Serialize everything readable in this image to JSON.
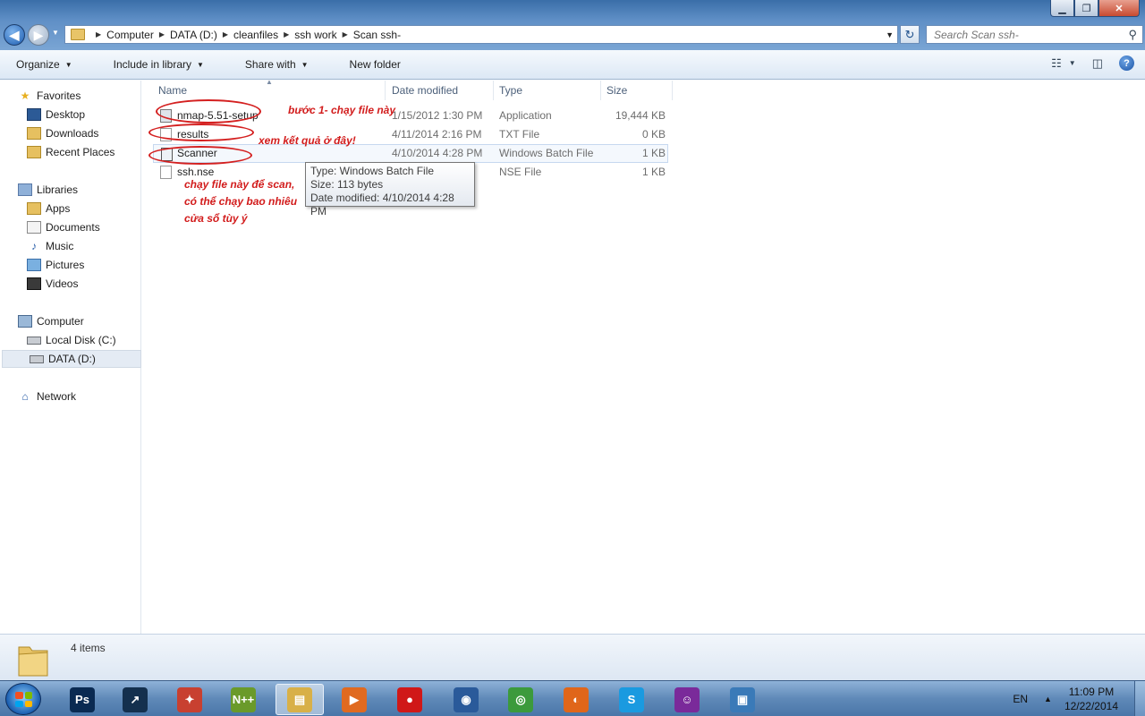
{
  "window": {
    "min_label": "▁",
    "max_label": "❐",
    "close_label": "✕"
  },
  "address": {
    "crumbs": [
      "Computer",
      "DATA (D:)",
      "cleanfiles",
      "ssh work",
      "Scan ssh-"
    ]
  },
  "search": {
    "placeholder": "Search Scan ssh-"
  },
  "toolbar": {
    "organize": "Organize",
    "include": "Include in library",
    "share": "Share with",
    "new_folder": "New folder"
  },
  "nav": {
    "favorites": "Favorites",
    "desktop": "Desktop",
    "downloads": "Downloads",
    "recent": "Recent Places",
    "libraries": "Libraries",
    "apps": "Apps",
    "documents": "Documents",
    "music": "Music",
    "pictures": "Pictures",
    "videos": "Videos",
    "computer": "Computer",
    "local_disk": "Local Disk (C:)",
    "data_disk": "DATA (D:)",
    "network": "Network"
  },
  "columns": {
    "name": "Name",
    "date": "Date modified",
    "type": "Type",
    "size": "Size"
  },
  "files": [
    {
      "name": "nmap-5.51-setup",
      "date": "1/15/2012 1:30 PM",
      "type": "Application",
      "size": "19,444 KB"
    },
    {
      "name": "results",
      "date": "4/11/2014 2:16 PM",
      "type": "TXT File",
      "size": "0 KB"
    },
    {
      "name": "Scanner",
      "date": "4/10/2014 4:28 PM",
      "type": "Windows Batch File",
      "size": "1 KB"
    },
    {
      "name": "ssh.nse",
      "date": "",
      "type": "NSE File",
      "size": "1 KB"
    }
  ],
  "tooltip": {
    "type": "Type: Windows Batch File",
    "size": "Size: 113 bytes",
    "date": "Date modified: 4/10/2014 4:28 PM"
  },
  "annotations": {
    "step1": "bước 1- chạy file này",
    "results": "xem kết quả ở đây!",
    "scan_line1": "chạy file này để scan,",
    "scan_line2": "có thể chạy bao nhiêu",
    "scan_line3": "cửa sổ tùy ý"
  },
  "details": {
    "count": "4 items"
  },
  "taskbar": {
    "apps": [
      {
        "name": "photoshop",
        "label": "Ps",
        "color": "#0a2a52"
      },
      {
        "name": "stocks",
        "label": "↗",
        "color": "#14304e"
      },
      {
        "name": "tools",
        "label": "✦",
        "color": "#c84030"
      },
      {
        "name": "notepadpp",
        "label": "N++",
        "color": "#6a9a2a"
      },
      {
        "name": "explorer",
        "label": "▤",
        "color": "#d8b048"
      },
      {
        "name": "media",
        "label": "▶",
        "color": "#e06a20"
      },
      {
        "name": "record",
        "label": "●",
        "color": "#d01818"
      },
      {
        "name": "player",
        "label": "◉",
        "color": "#2a5a9a"
      },
      {
        "name": "chrome",
        "label": "◎",
        "color": "#3c9a3c"
      },
      {
        "name": "firefox",
        "label": "◐",
        "color": "#e0661a"
      },
      {
        "name": "skype",
        "label": "S",
        "color": "#1a9ae0"
      },
      {
        "name": "yahoo",
        "label": "☺",
        "color": "#7a2a9a"
      },
      {
        "name": "photos",
        "label": "▣",
        "color": "#3a7ab8"
      }
    ],
    "lang": "EN",
    "time": "11:09 PM",
    "date": "12/22/2014"
  }
}
